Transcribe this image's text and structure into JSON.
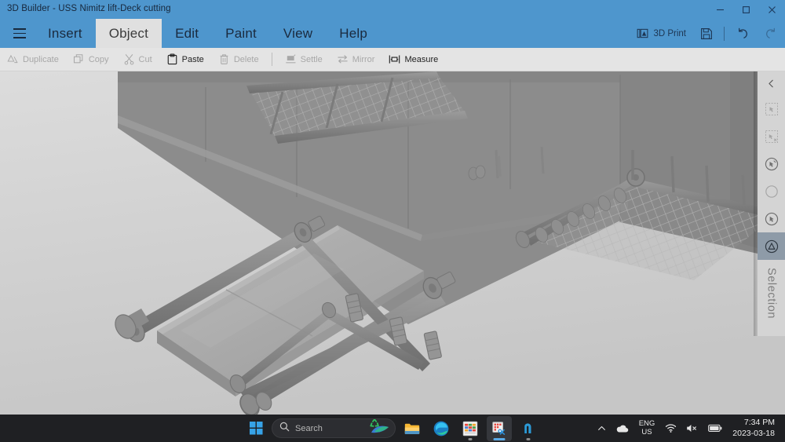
{
  "window": {
    "title": "3D Builder - USS Nimitz lift-Deck cutting",
    "controls": {
      "minimize": "minimize-button",
      "maximize": "maximize-button",
      "close": "close-button"
    }
  },
  "menubar": {
    "hamburger": "menu-icon",
    "items": [
      {
        "label": "Insert",
        "active": false
      },
      {
        "label": "Object",
        "active": true
      },
      {
        "label": "Edit",
        "active": false
      },
      {
        "label": "Paint",
        "active": false
      },
      {
        "label": "View",
        "active": false
      },
      {
        "label": "Help",
        "active": false
      }
    ],
    "right_actions": [
      {
        "label": "3D Print",
        "icon": "3d-print-icon",
        "enabled": true
      },
      {
        "label": "",
        "icon": "save-icon",
        "enabled": true
      },
      {
        "label": "",
        "icon": "undo-icon",
        "enabled": true
      },
      {
        "label": "",
        "icon": "redo-icon",
        "enabled": false
      }
    ]
  },
  "toolbar": {
    "items": [
      {
        "label": "Duplicate",
        "icon": "duplicate-icon",
        "enabled": false
      },
      {
        "label": "Copy",
        "icon": "copy-icon",
        "enabled": false
      },
      {
        "label": "Cut",
        "icon": "cut-icon",
        "enabled": false
      },
      {
        "label": "Paste",
        "icon": "paste-icon",
        "enabled": true
      },
      {
        "label": "Delete",
        "icon": "delete-icon",
        "enabled": false
      },
      {
        "label": "Settle",
        "icon": "settle-icon",
        "enabled": false
      },
      {
        "label": "Mirror",
        "icon": "mirror-icon",
        "enabled": false
      },
      {
        "label": "Measure",
        "icon": "measure-icon",
        "enabled": true
      }
    ]
  },
  "right_panel": {
    "collapse_icon": "chevron-left-icon",
    "label": "Selection",
    "tools": [
      {
        "icon": "select-all-icon",
        "enabled": false,
        "selected": false
      },
      {
        "icon": "deselect-all-icon",
        "enabled": false,
        "selected": false
      },
      {
        "icon": "invert-selection-icon",
        "enabled": true,
        "selected": false
      },
      {
        "icon": "circle-select-icon",
        "enabled": false,
        "selected": false
      },
      {
        "icon": "select-object-icon",
        "enabled": true,
        "selected": false
      },
      {
        "icon": "select-triangle-icon",
        "enabled": true,
        "selected": true
      }
    ]
  },
  "viewport": {
    "model_name": "uss-nimitz-lift-deck-3d-model",
    "background_top": "#d9d9d9",
    "background_bottom": "#c8c8c8"
  },
  "taskbar": {
    "start": "windows-start-icon",
    "search": {
      "placeholder": "Search",
      "icon": "search-icon"
    },
    "apps": [
      {
        "name": "file-explorer",
        "state": "idle"
      },
      {
        "name": "microsoft-edge",
        "state": "idle"
      },
      {
        "name": "spreadsheet-app",
        "state": "running"
      },
      {
        "name": "3d-builder",
        "state": "active"
      },
      {
        "name": "notes-app",
        "state": "running"
      }
    ],
    "tray": {
      "overflow": "chevron-up-icon",
      "cloud": "onedrive-icon",
      "language_line1": "ENG",
      "language_line2": "US",
      "wifi": "wifi-icon",
      "volume": "volume-muted-icon",
      "battery": "battery-icon",
      "time": "7:34 PM",
      "date": "2023-03-18"
    }
  }
}
